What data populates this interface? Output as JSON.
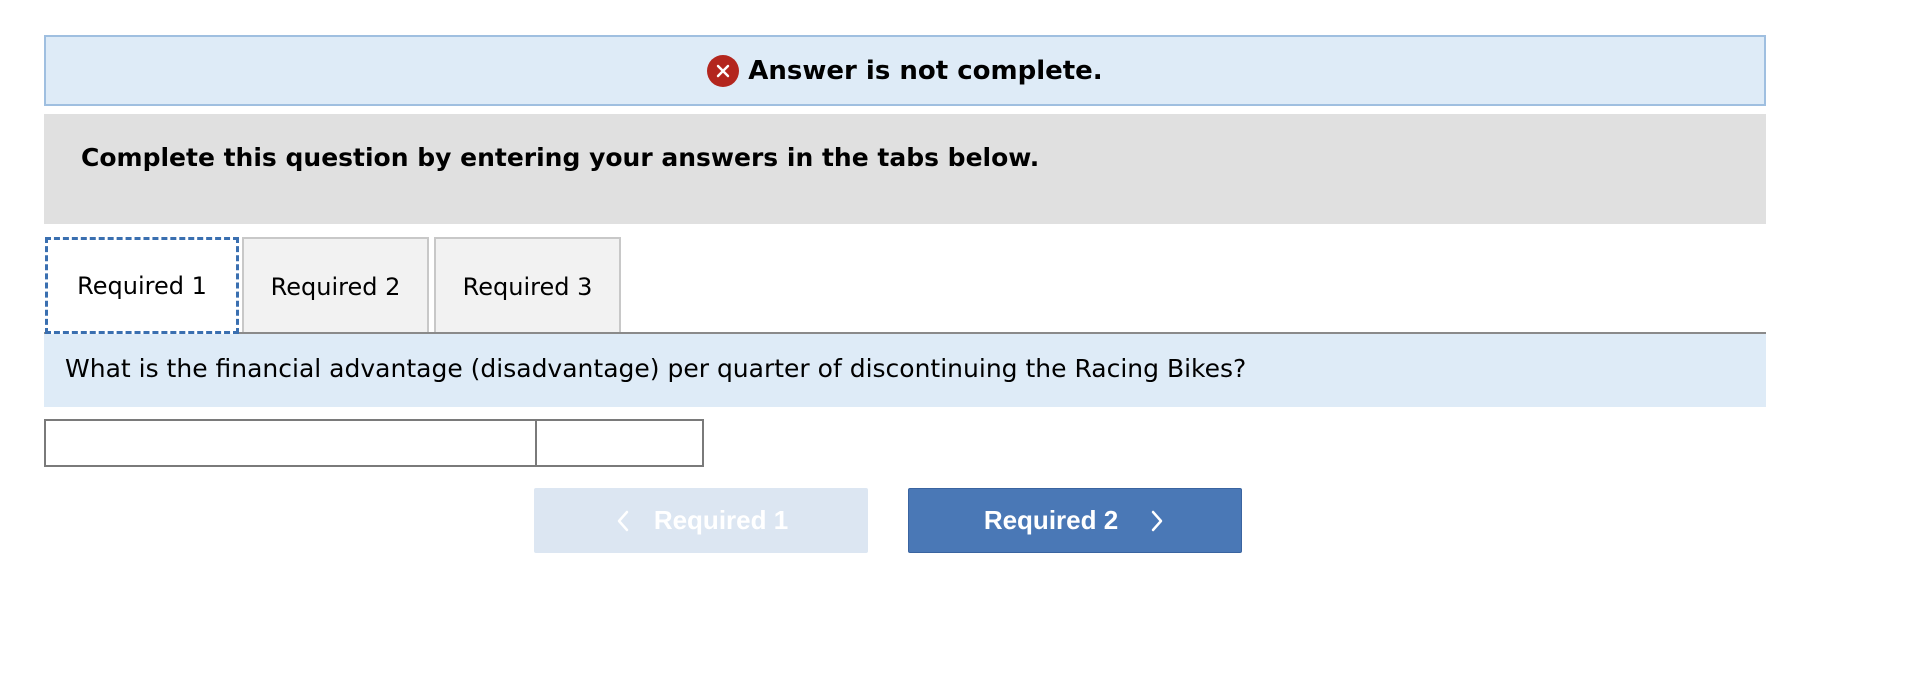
{
  "status": {
    "icon": "error-x-icon",
    "text": "Answer is not complete.",
    "color": "#b3261e"
  },
  "instruction": {
    "text": "Complete this question by entering your answers in the tabs below."
  },
  "tabs": [
    {
      "label": "Required 1",
      "active": true
    },
    {
      "label": "Required 2",
      "active": false
    },
    {
      "label": "Required 3",
      "active": false
    }
  ],
  "question": {
    "text": "What is the financial advantage (disadvantage) per quarter of discontinuing the Racing Bikes?"
  },
  "answer": {
    "label_value": "",
    "amount_value": ""
  },
  "navigation": {
    "prev_label": "Required 1",
    "prev_icon": "chevron-left-icon",
    "next_label": "Required 2",
    "next_icon": "chevron-right-icon",
    "accent": "#4a78b6"
  }
}
